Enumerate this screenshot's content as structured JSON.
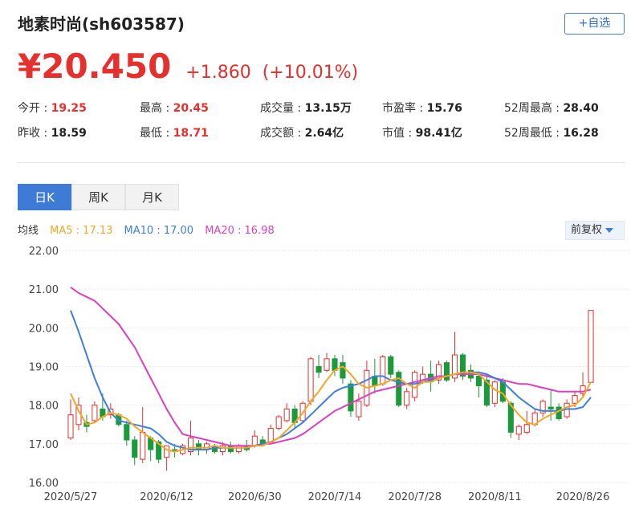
{
  "header": {
    "title": "地素时尚(sh603587)",
    "follow_label": "+自选"
  },
  "quote": {
    "price": "¥20.450",
    "change": "+1.860",
    "change_pct": "(+10.01%)"
  },
  "stats": [
    {
      "label": "今开 : ",
      "value": "19.25",
      "up": true
    },
    {
      "label": "最高 : ",
      "value": "20.45",
      "up": true
    },
    {
      "label": "成交量 : ",
      "value": "13.15万",
      "up": false
    },
    {
      "label": "市盈率 : ",
      "value": "15.76",
      "up": false
    },
    {
      "label": "52周最高 : ",
      "value": "28.40",
      "up": false
    },
    {
      "label": "昨收 : ",
      "value": "18.59",
      "up": false
    },
    {
      "label": "最低 : ",
      "value": "18.71",
      "up": true
    },
    {
      "label": "成交额 : ",
      "value": "2.64亿",
      "up": false
    },
    {
      "label": "市值 : ",
      "value": "98.41亿",
      "up": false
    },
    {
      "label": "52周最低 : ",
      "value": "16.28",
      "up": false
    }
  ],
  "tabs": [
    {
      "label": "日K",
      "active": true
    },
    {
      "label": "周K",
      "active": false
    },
    {
      "label": "月K",
      "active": false
    }
  ],
  "ma_legend": {
    "label": "均线",
    "ma5": "MA5 : 17.13",
    "ma10": "MA10 : 17.00",
    "ma20": "MA20 : 16.98"
  },
  "adjust_label": "前复权",
  "colors": {
    "up": "#e5302e",
    "down": "#1a9a3a",
    "ma5": "#f5a623",
    "ma10": "#3d7fe0",
    "ma20": "#dd3fc0",
    "accent": "#3d7bd6"
  },
  "chart_data": {
    "type": "candlestick",
    "ylim": [
      16.0,
      22.0
    ],
    "yticks": [
      "22.00",
      "21.00",
      "20.00",
      "19.00",
      "18.00",
      "17.00",
      "16.00"
    ],
    "xticks": [
      {
        "label": "2020/5/27",
        "index": 0
      },
      {
        "label": "2020/6/12",
        "index": 12
      },
      {
        "label": "2020/6/30",
        "index": 23
      },
      {
        "label": "2020/7/14",
        "index": 33
      },
      {
        "label": "2020/7/28",
        "index": 43
      },
      {
        "label": "2020/8/11",
        "index": 53
      },
      {
        "label": "2020/8/26",
        "index": 64
      }
    ],
    "candles": [
      [
        17.15,
        17.75,
        17.1,
        18.15
      ],
      [
        17.5,
        18.0,
        17.35,
        18.2
      ],
      [
        17.55,
        17.45,
        17.3,
        17.75
      ],
      [
        17.6,
        18.0,
        17.55,
        18.1
      ],
      [
        17.9,
        17.7,
        17.6,
        18.3
      ],
      [
        17.75,
        17.9,
        17.65,
        18.05
      ],
      [
        17.75,
        17.5,
        17.45,
        17.8
      ],
      [
        17.5,
        17.1,
        16.95,
        17.6
      ],
      [
        17.1,
        16.65,
        16.45,
        17.2
      ],
      [
        16.6,
        17.3,
        16.5,
        17.95
      ],
      [
        17.15,
        16.85,
        16.55,
        17.2
      ],
      [
        17.05,
        16.6,
        16.5,
        17.1
      ],
      [
        16.65,
        16.95,
        16.3,
        16.95
      ],
      [
        16.85,
        16.8,
        16.65,
        17.0
      ],
      [
        16.75,
        16.95,
        16.7,
        17.0
      ],
      [
        16.8,
        17.15,
        16.7,
        17.6
      ],
      [
        17.0,
        16.85,
        16.7,
        17.1
      ],
      [
        16.85,
        17.0,
        16.75,
        17.05
      ],
      [
        16.95,
        16.8,
        16.75,
        17.0
      ],
      [
        16.8,
        16.95,
        16.7,
        17.05
      ],
      [
        16.95,
        16.8,
        16.75,
        17.05
      ],
      [
        16.8,
        16.95,
        16.75,
        17.0
      ],
      [
        16.95,
        16.85,
        16.8,
        17.1
      ],
      [
        16.95,
        17.2,
        16.9,
        17.35
      ],
      [
        17.1,
        17.0,
        16.95,
        17.2
      ],
      [
        17.05,
        17.4,
        17.0,
        17.5
      ],
      [
        17.4,
        17.7,
        17.35,
        17.75
      ],
      [
        17.6,
        17.9,
        17.55,
        18.05
      ],
      [
        17.9,
        17.55,
        17.4,
        18.0
      ],
      [
        17.6,
        18.05,
        17.55,
        18.1
      ],
      [
        18.1,
        19.2,
        18.0,
        19.25
      ],
      [
        19.0,
        18.85,
        18.7,
        19.3
      ],
      [
        18.9,
        19.2,
        18.85,
        19.35
      ],
      [
        19.2,
        18.9,
        18.75,
        19.3
      ],
      [
        19.1,
        18.7,
        18.55,
        19.3
      ],
      [
        18.55,
        17.85,
        17.7,
        18.65
      ],
      [
        17.7,
        18.1,
        17.6,
        18.3
      ],
      [
        18.0,
        18.9,
        17.95,
        19.15
      ],
      [
        18.75,
        18.5,
        18.3,
        19.2
      ],
      [
        18.55,
        19.25,
        18.5,
        19.3
      ],
      [
        19.25,
        18.8,
        18.7,
        19.3
      ],
      [
        18.85,
        18.0,
        17.95,
        18.9
      ],
      [
        18.0,
        18.35,
        17.9,
        18.45
      ],
      [
        18.2,
        18.85,
        18.1,
        18.9
      ],
      [
        18.6,
        18.8,
        18.55,
        19.0
      ],
      [
        18.8,
        18.6,
        18.35,
        19.15
      ],
      [
        18.65,
        19.05,
        18.55,
        19.15
      ],
      [
        19.1,
        18.65,
        18.6,
        19.15
      ],
      [
        18.7,
        19.3,
        18.6,
        19.9
      ],
      [
        19.3,
        18.75,
        18.65,
        19.35
      ],
      [
        18.9,
        18.7,
        18.6,
        19.05
      ],
      [
        18.75,
        18.5,
        18.2,
        18.8
      ],
      [
        18.65,
        18.0,
        17.95,
        18.8
      ],
      [
        18.05,
        18.6,
        17.95,
        18.65
      ],
      [
        18.6,
        18.1,
        18.05,
        18.7
      ],
      [
        18.05,
        17.3,
        17.15,
        18.1
      ],
      [
        17.25,
        17.45,
        17.1,
        17.5
      ],
      [
        17.3,
        17.5,
        17.25,
        17.85
      ],
      [
        17.5,
        17.8,
        17.45,
        17.9
      ],
      [
        17.8,
        18.1,
        17.7,
        18.15
      ],
      [
        17.95,
        17.9,
        17.6,
        18.4
      ],
      [
        17.95,
        17.65,
        17.6,
        18.05
      ],
      [
        17.7,
        18.05,
        17.65,
        18.15
      ],
      [
        18.05,
        18.25,
        17.95,
        18.35
      ],
      [
        18.3,
        18.5,
        18.2,
        18.85
      ],
      [
        18.59,
        20.45,
        18.71,
        20.45
      ]
    ],
    "ma5": [
      18.3,
      17.85,
      17.5,
      17.55,
      17.7,
      17.8,
      17.75,
      17.65,
      17.45,
      17.3,
      17.15,
      17.0,
      16.85,
      16.8,
      16.85,
      16.9,
      16.9,
      16.9,
      16.95,
      16.9,
      16.9,
      16.9,
      16.9,
      16.95,
      16.95,
      17.05,
      17.15,
      17.35,
      17.55,
      17.8,
      18.1,
      18.35,
      18.65,
      18.9,
      19.0,
      18.8,
      18.55,
      18.45,
      18.5,
      18.55,
      18.65,
      18.7,
      18.55,
      18.45,
      18.6,
      18.6,
      18.7,
      18.75,
      18.8,
      18.85,
      18.85,
      18.8,
      18.6,
      18.4,
      18.3,
      18.0,
      17.75,
      17.55,
      17.5,
      17.65,
      17.75,
      17.85,
      17.95,
      18.0,
      18.2,
      18.6
    ],
    "ma10": [
      20.45,
      19.9,
      19.3,
      18.7,
      18.2,
      17.8,
      17.6,
      17.55,
      17.5,
      17.45,
      17.4,
      17.25,
      17.05,
      16.95,
      16.9,
      16.85,
      16.85,
      16.85,
      16.9,
      16.9,
      16.9,
      16.9,
      16.9,
      16.95,
      17.0,
      17.05,
      17.15,
      17.25,
      17.4,
      17.55,
      17.75,
      17.95,
      18.15,
      18.35,
      18.45,
      18.5,
      18.55,
      18.65,
      18.75,
      18.75,
      18.65,
      18.6,
      18.55,
      18.55,
      18.6,
      18.65,
      18.7,
      18.75,
      18.8,
      18.85,
      18.85,
      18.85,
      18.8,
      18.7,
      18.6,
      18.4,
      18.2,
      18.05,
      17.9,
      17.85,
      17.85,
      17.85,
      17.9,
      17.9,
      17.95,
      18.2
    ],
    "ma20": [
      21.05,
      20.9,
      20.8,
      20.7,
      20.5,
      20.3,
      20.1,
      19.8,
      19.5,
      19.1,
      18.7,
      18.3,
      17.9,
      17.55,
      17.25,
      17.2,
      17.15,
      17.1,
      17.05,
      17.0,
      16.95,
      16.95,
      16.95,
      16.95,
      17.0,
      17.0,
      17.05,
      17.1,
      17.15,
      17.25,
      17.4,
      17.55,
      17.7,
      17.85,
      17.95,
      18.05,
      18.15,
      18.25,
      18.35,
      18.4,
      18.45,
      18.5,
      18.55,
      18.6,
      18.65,
      18.7,
      18.75,
      18.75,
      18.8,
      18.8,
      18.8,
      18.8,
      18.75,
      18.7,
      18.65,
      18.6,
      18.55,
      18.55,
      18.5,
      18.45,
      18.4,
      18.35,
      18.35,
      18.35,
      18.35,
      18.4
    ]
  }
}
